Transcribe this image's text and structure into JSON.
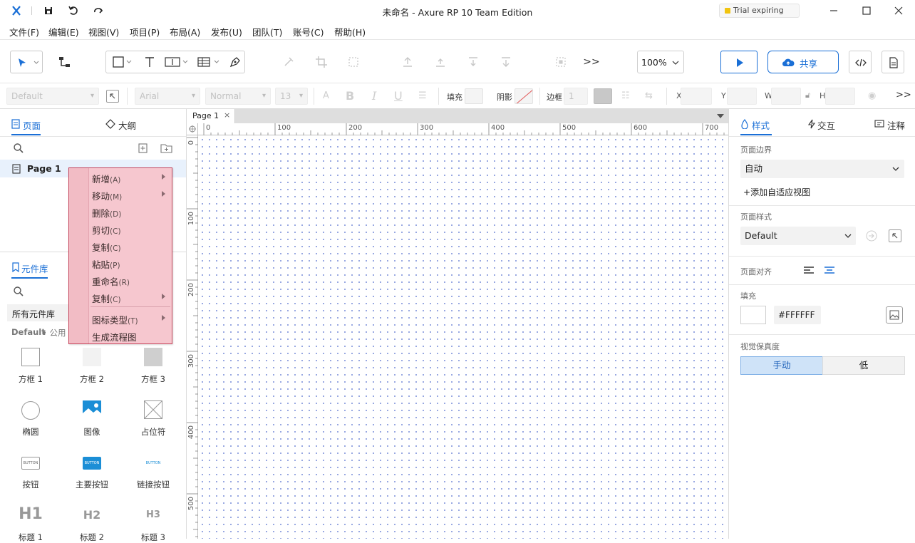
{
  "window": {
    "title": "未命名 - Axure RP 10 Team Edition",
    "trial": "Trial expiring soon"
  },
  "menubar": [
    "文件(F)",
    "编辑(E)",
    "视图(V)",
    "项目(P)",
    "布局(A)",
    "发布(U)",
    "团队(T)",
    "账号(C)",
    "帮助(H)"
  ],
  "toolbar": {
    "zoom": "100%",
    "share_label": "共享",
    "more": ">>"
  },
  "formatbar": {
    "style_select": "Default",
    "font_select": "Arial",
    "weight_select": "Normal",
    "size_select": "13",
    "fill_label": "填充",
    "shadow_label": "阴影",
    "border_label": "边框",
    "border_value": "1",
    "x_label": "X",
    "y_label": "Y",
    "w_label": "W",
    "h_label": "H",
    "more": ">>"
  },
  "left_panel": {
    "pages_tab": "页面",
    "outline_tab": "大纲",
    "page_item": "Page 1",
    "library_tab": "元件库",
    "library_select": "所有元件库",
    "library_group": "Default",
    "library_group_sub": "• 公用",
    "widgets": [
      {
        "label": "方框 1",
        "icon": "box-white-icon"
      },
      {
        "label": "方框 2",
        "icon": "box-lightgray-icon"
      },
      {
        "label": "方框 3",
        "icon": "box-gray-icon"
      },
      {
        "label": "椭圆",
        "icon": "ellipse-icon"
      },
      {
        "label": "图像",
        "icon": "image-icon"
      },
      {
        "label": "占位符",
        "icon": "placeholder-icon"
      },
      {
        "label": "按钮",
        "icon": "button-icon",
        "glyph": "BUTTON"
      },
      {
        "label": "主要按钮",
        "icon": "primary-button-icon",
        "glyph": "BUTTON"
      },
      {
        "label": "链接按钮",
        "icon": "link-button-icon",
        "glyph": "BUTTON"
      },
      {
        "label": "标题 1",
        "icon": "h1-icon",
        "glyph": "H1"
      },
      {
        "label": "标题 2",
        "icon": "h2-icon",
        "glyph": "H2"
      },
      {
        "label": "标题 3",
        "icon": "h3-icon",
        "glyph": "H3"
      }
    ]
  },
  "context_menu": [
    {
      "label": "新增",
      "key": "(A)",
      "submenu": true
    },
    {
      "label": "移动",
      "key": "(M)",
      "submenu": true
    },
    {
      "label": "删除",
      "key": "(D)",
      "submenu": false
    },
    {
      "label": "剪切",
      "key": "(C)",
      "submenu": false
    },
    {
      "label": "复制",
      "key": "(C)",
      "submenu": false
    },
    {
      "label": "粘贴",
      "key": "(P)",
      "submenu": false
    },
    {
      "label": "重命名",
      "key": "(R)",
      "submenu": false
    },
    {
      "label": "复制",
      "key": "(C)",
      "submenu": true
    },
    {
      "label": "图标类型",
      "key": "(T)",
      "submenu": true
    },
    {
      "label": "生成流程图",
      "key": "",
      "submenu": false
    }
  ],
  "canvas": {
    "tab": "Page 1",
    "h_ruler": [
      "0",
      "100",
      "200",
      "300",
      "400",
      "500",
      "600",
      "700"
    ],
    "v_ruler": [
      "0",
      "100",
      "200",
      "300",
      "400",
      "500"
    ]
  },
  "right_panel": {
    "style_tab": "样式",
    "interact_tab": "交互",
    "notes_tab": "注释",
    "page_bounds_label": "页面边界",
    "page_bounds_value": "自动",
    "add_adaptive": "添加自适应视图",
    "page_style_label": "页面样式",
    "page_style_value": "Default",
    "page_align_label": "页面对齐",
    "fill_label": "填充",
    "fill_hex": "#FFFFFF",
    "fidelity_label": "视觉保真度",
    "fidelity_manual": "手动",
    "fidelity_low": "低"
  },
  "colors": {
    "accent": "#1a6fd6",
    "menu_bg": "#f6c7cf",
    "menu_border": "#c6475d"
  }
}
